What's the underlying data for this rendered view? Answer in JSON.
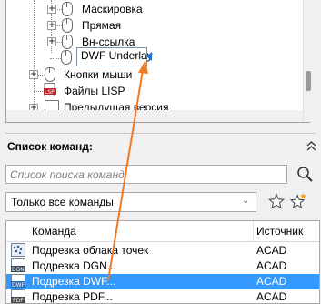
{
  "tree": {
    "items": [
      {
        "label": "Маскировка"
      },
      {
        "label": "Прямая"
      },
      {
        "label": "Вн-ссылка"
      },
      {
        "label": "DWF Underlay"
      },
      {
        "label": "Кнопки мыши"
      },
      {
        "label": "Файлы LISP"
      },
      {
        "label": "Предыдущая версия"
      }
    ]
  },
  "command_list": {
    "title": "Список команд:",
    "search_placeholder": "Список поиска команд",
    "filter_value": "Только все команды",
    "columns": {
      "command": "Команда",
      "source": "Источник"
    },
    "rows": [
      {
        "name": "Подрезка облака точек",
        "source": "ACAD",
        "icon": "point-cloud-clip-icon"
      },
      {
        "name": "Подрезка DGN...",
        "source": "ACAD",
        "icon": "dgn-clip-icon"
      },
      {
        "name": "Подрезка DWF...",
        "source": "ACAD",
        "icon": "dwf-clip-icon",
        "selected": true
      },
      {
        "name": "Подрезка PDF...",
        "source": "ACAD",
        "icon": "pdf-clip-icon"
      }
    ]
  },
  "colors": {
    "selection": "#3399ff",
    "arrow": "#f07a22",
    "pointer": "#1e6fd9"
  }
}
